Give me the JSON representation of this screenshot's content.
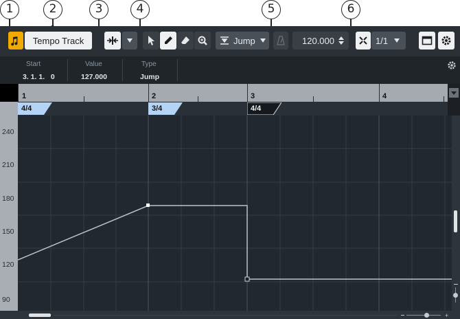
{
  "callouts": [
    "1",
    "2",
    "3",
    "4",
    "5",
    "6"
  ],
  "toolbar": {
    "tempo_track_label": "Tempo Track",
    "snap_label": "Jump",
    "tempo_value": "120.000",
    "quantize_label": "1/1"
  },
  "info_line": {
    "start_label": "Start",
    "start_value": "3. 1. 1.   0",
    "value_label": "Value",
    "value_value": "127.000",
    "type_label": "Type",
    "type_value": "Jump"
  },
  "ruler": {
    "bars": [
      "1",
      "2",
      "3",
      "4"
    ]
  },
  "signatures": [
    "4/4",
    "3/4",
    "4/4"
  ],
  "tempo_scale": [
    "240",
    "210",
    "180",
    "150",
    "120",
    "90"
  ],
  "colors": {
    "accent": "#f2a900",
    "background": "#22282f",
    "curve": "#b9c2cb",
    "signature_tag": "#b4d3f5"
  },
  "icons": {
    "tempo_track": "tempo-note-icon",
    "insert": "insert-arrows-icon",
    "select": "pointer-icon",
    "draw": "pencil-icon",
    "erase": "eraser-icon",
    "zoom": "zoom-icon",
    "snap_type": "jump-icon",
    "tempo_mode": "metronome-icon",
    "snap": "snap-icon",
    "window": "window-icon",
    "settings": "gear-icon"
  }
}
